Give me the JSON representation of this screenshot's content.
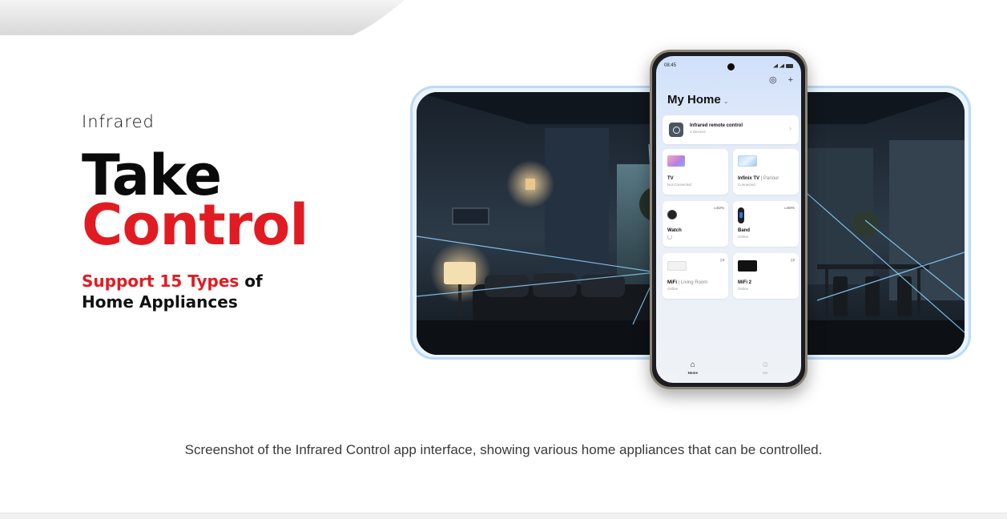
{
  "hero": {
    "eyebrow": "Infrared",
    "title_line1": "Take",
    "title_line2": "Control",
    "subtitle_accent": "Support 15 Types",
    "subtitle_rest": " of",
    "subtitle_line2": "Home Appliances"
  },
  "phone": {
    "status_time": "08:45",
    "home_title": "My Home",
    "ir_card": {
      "title": "Infrared remote control",
      "status": "4 Devices"
    },
    "devices": [
      {
        "name": "TV",
        "room": "",
        "status": "Not Connected",
        "badge": ""
      },
      {
        "name": "Infinix TV",
        "room": "Parlour",
        "status": "Connected",
        "badge": ""
      },
      {
        "name": "Watch",
        "room": "",
        "status": "",
        "badge": "82%"
      },
      {
        "name": "Band",
        "room": "",
        "status": "Online",
        "badge": "80%"
      },
      {
        "name": "MiFi",
        "room": "Living Room",
        "status": "Online",
        "badge": "3"
      },
      {
        "name": "MiFi 2",
        "room": "",
        "status": "Online",
        "badge": "2"
      }
    ],
    "nav": {
      "home_label": "Home",
      "me_label": "Me"
    }
  },
  "caption": "Screenshot of the Infrared Control app interface, showing various home appliances that can be controlled.",
  "colors": {
    "accent_red": "#e21b23",
    "frame_blue": "#bcdaf6",
    "text_dark": "#0a0a0a"
  }
}
